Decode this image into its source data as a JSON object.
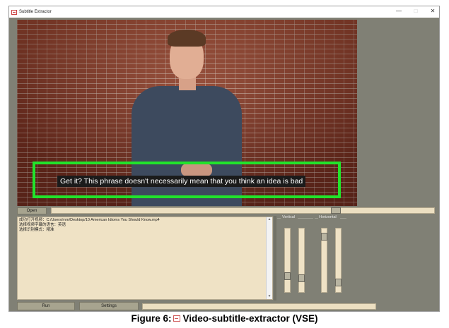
{
  "window": {
    "title": "Subtitle Extractor",
    "controls": [
      "—",
      "□",
      "✕"
    ]
  },
  "video": {
    "subtitle": "Get it? This phrase doesn't necessarily mean that you think an idea is bad"
  },
  "toolbar": {
    "open_label": "Open",
    "progress": 0.75
  },
  "log": {
    "lines": [
      "成功打开视频：C:/Users/mm/Desktop/10 American Idioms You Should Know.mp4",
      "选择视频字幕的语言：英语",
      "选择识别模式：精准"
    ]
  },
  "sliders": {
    "vertical_label": "Vertical",
    "horizontal_label": "Horizontal",
    "vertical": [
      0.78,
      0.82
    ],
    "horizontal": [
      0.07,
      0.9
    ]
  },
  "bottom": {
    "run_label": "Run",
    "settings_label": "Settings"
  },
  "caption": {
    "prefix": "Figure 6:",
    "text": "Video-subtitle-extractor (VSE)"
  },
  "colors": {
    "detection_box": "#21e42b",
    "panel_bg": "#808075",
    "field_bg": "#efe2c5"
  }
}
